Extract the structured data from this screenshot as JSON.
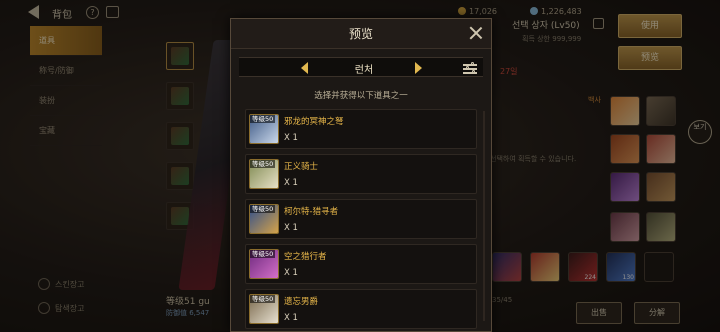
{
  "topbar": {
    "title": "背包",
    "help": "?",
    "res1": "17,026",
    "res2": "1,226,483"
  },
  "leftnav": {
    "items": [
      {
        "label": "道具",
        "active": true
      },
      {
        "label": "称号/防御",
        "active": false
      },
      {
        "label": "装扮",
        "active": false
      },
      {
        "label": "宝藏",
        "active": false
      }
    ],
    "footer": [
      "스킨장고",
      "탐색장고"
    ]
  },
  "character": {
    "level_text": "等级51 gu",
    "power_label": "防御值 6,547"
  },
  "right_panel": {
    "title": "선택 상자 (Lv50)",
    "sub_label": "획득 상한",
    "sub_value": "999,999",
    "red_text": "27일",
    "orange_text": "백사",
    "desc": "선택하여 획득할 수 있습니다.",
    "count": "35/45",
    "buttons": {
      "use": "使用",
      "preview": "预览"
    },
    "side_label": "보기",
    "items": [
      {
        "qty": ""
      },
      {
        "qty": ""
      },
      {
        "qty": ""
      },
      {
        "qty": ""
      },
      {
        "qty": "224"
      },
      {
        "qty": "130"
      }
    ]
  },
  "bottom_buttons": {
    "sell": "出售",
    "dismantle": "分解"
  },
  "modal": {
    "title": "预览",
    "class_name": "런처",
    "instruction": "选择并获得以下道具之一",
    "items": [
      {
        "level": "等级50",
        "name": "邪龙的冥神之弩",
        "qty": "X 1",
        "color1": "#3f5a86",
        "color2": "#c9d7ea"
      },
      {
        "level": "等级50",
        "name": "正义骑士",
        "qty": "X 1",
        "color1": "#7f8a52",
        "color2": "#e8e1c6"
      },
      {
        "level": "等级50",
        "name": "柯尔特-猎寻者",
        "qty": "X 1",
        "color1": "#2f4e8c",
        "color2": "#d3a24a"
      },
      {
        "level": "等级50",
        "name": "空之猎行者",
        "qty": "X 1",
        "color1": "#6e2a7e",
        "color2": "#d46fc9"
      },
      {
        "level": "等级50",
        "name": "遗忘男爵",
        "qty": "X 1",
        "color1": "#7b6a4e",
        "color2": "#e7e0d0"
      }
    ]
  }
}
